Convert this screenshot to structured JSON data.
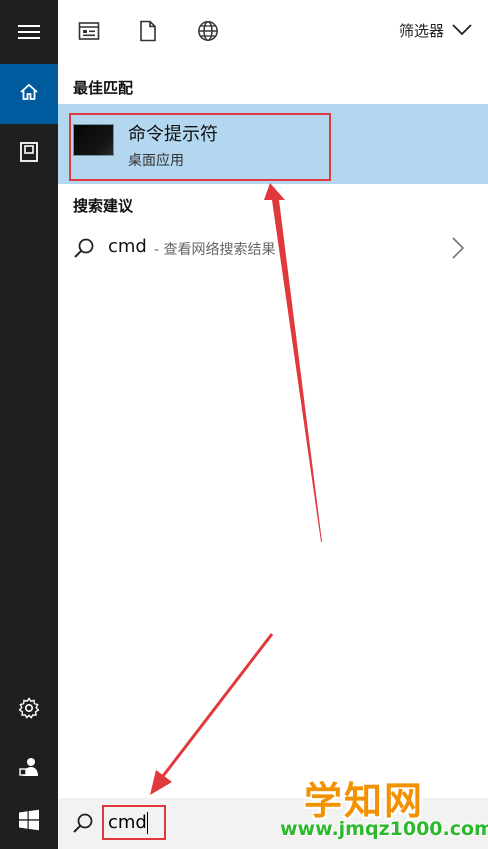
{
  "sidebar": {
    "items": [
      {
        "name": "hamburger-menu-icon"
      },
      {
        "name": "home-icon",
        "active": true
      },
      {
        "name": "document-icon"
      },
      {
        "name": "gear-icon"
      },
      {
        "name": "user-icon"
      },
      {
        "name": "windows-start-icon"
      }
    ]
  },
  "toolbar": {
    "icons": [
      "apps-filter-icon",
      "documents-filter-icon",
      "web-filter-icon"
    ],
    "filter_label": "筛选器"
  },
  "results": {
    "best_match_title": "最佳匹配",
    "best_match": {
      "name": "命令提示符",
      "type": "桌面应用"
    },
    "suggestions_title": "搜索建议",
    "suggestion": {
      "term": "cmd",
      "hint": "- 查看网络搜索结果"
    }
  },
  "search": {
    "value": "cmd"
  },
  "watermark": {
    "brand": "学知网",
    "url": "www.jmqz1000.com"
  },
  "colors": {
    "sidebar_bg": "#1f1f1f",
    "sidebar_active": "#005a9e",
    "highlight_bg": "#b4d7f0",
    "annotation_red": "#e0383b",
    "watermark_orange": "#f29200",
    "watermark_green": "#2eb82e"
  }
}
